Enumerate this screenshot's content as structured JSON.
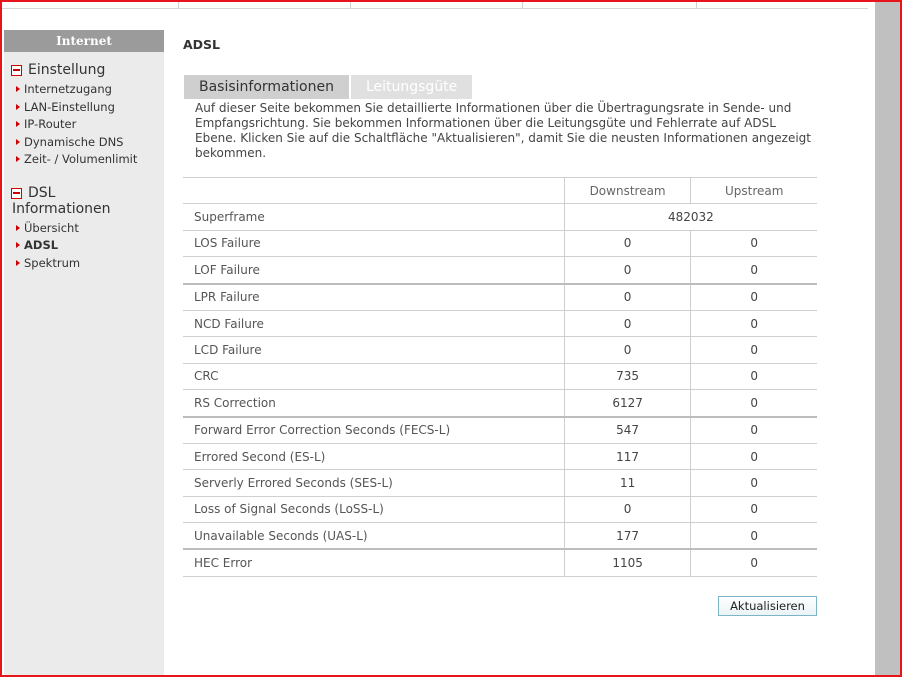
{
  "sidebar": {
    "header": "Internet",
    "groups": [
      {
        "title": "Einstellung",
        "items": [
          "Internetzugang",
          "LAN-Einstellung",
          "IP-Router",
          "Dynamische DNS",
          "Zeit- / Volumenlimit"
        ]
      },
      {
        "title_line1": "DSL",
        "title_line2": "Informationen",
        "items": [
          "Übersicht",
          "ADSL",
          "Spektrum"
        ]
      }
    ]
  },
  "page": {
    "title": "ADSL",
    "tabs": [
      "Basisinformationen",
      "Leitungsgüte"
    ],
    "description": "Auf dieser Seite bekommen Sie detaillierte Informationen über die Übertragungsrate in Sende- und Empfangsrichtung. Sie bekommen Informationen über die Leitungsgüte und Fehlerrate auf ADSL Ebene. Klicken Sie auf die Schaltfläche \"Aktualisieren\", damit Sie die neusten Informationen angezeigt bekommen.",
    "refresh_label": "Aktualisieren"
  },
  "table": {
    "headers": [
      "Downstream",
      "Upstream"
    ],
    "superframe": {
      "label": "Superframe",
      "value": "482032"
    },
    "rows": [
      {
        "label": "LOS Failure",
        "down": "0",
        "up": "0"
      },
      {
        "label": "LOF Failure",
        "down": "0",
        "up": "0"
      },
      {
        "label": "LPR Failure",
        "down": "0",
        "up": "0"
      },
      {
        "label": "NCD Failure",
        "down": "0",
        "up": "0"
      },
      {
        "label": "LCD Failure",
        "down": "0",
        "up": "0"
      },
      {
        "label": "CRC",
        "down": "735",
        "up": "0"
      },
      {
        "label": "RS Correction",
        "down": "6127",
        "up": "0"
      },
      {
        "label": "Forward Error Correction Seconds (FECS-L)",
        "down": "547",
        "up": "0"
      },
      {
        "label": "Errored Second (ES-L)",
        "down": "117",
        "up": "0"
      },
      {
        "label": "Serverly Errored Seconds (SES-L)",
        "down": "11",
        "up": "0"
      },
      {
        "label": "Loss of Signal Seconds (LoSS-L)",
        "down": "0",
        "up": "0"
      },
      {
        "label": "Unavailable Seconds (UAS-L)",
        "down": "177",
        "up": "0"
      },
      {
        "label": "HEC Error",
        "down": "1105",
        "up": "0"
      }
    ]
  }
}
